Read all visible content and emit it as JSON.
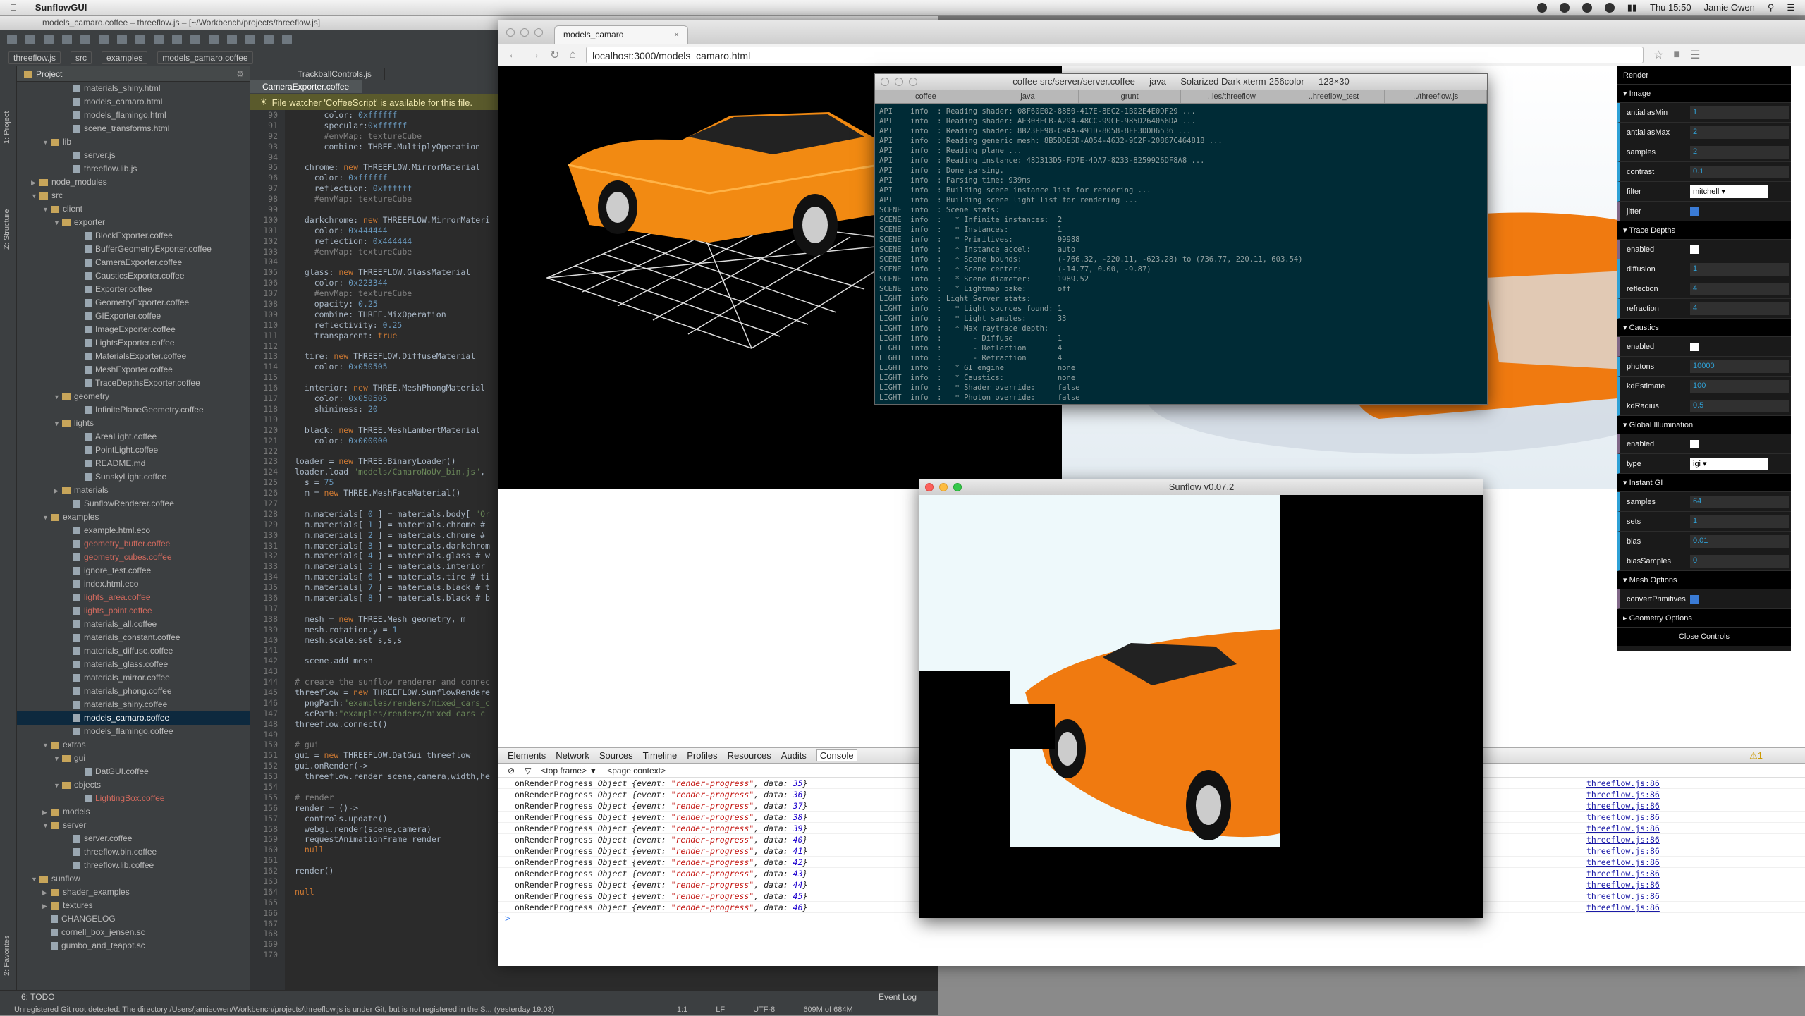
{
  "menubar": {
    "app": "SunflowGUI",
    "clock": "Thu 15:50",
    "user": "Jamie Owen"
  },
  "ide": {
    "title": "models_camaro.coffee – threeflow.js – [~/Workbench/projects/threeflow.js]",
    "crumbs": [
      "threeflow.js",
      "src",
      "examples",
      "models_camaro.coffee"
    ],
    "project_label": "Project",
    "side_labels": [
      "1: Project",
      "Z: Structure",
      "2: Favorites"
    ],
    "tree": [
      {
        "t": "materials_shiny.html",
        "d": 4,
        "k": "f"
      },
      {
        "t": "models_camaro.html",
        "d": 4,
        "k": "f"
      },
      {
        "t": "models_flamingo.html",
        "d": 4,
        "k": "f"
      },
      {
        "t": "scene_transforms.html",
        "d": 4,
        "k": "f"
      },
      {
        "t": "lib",
        "d": 2,
        "k": "o"
      },
      {
        "t": "server.js",
        "d": 4,
        "k": "f"
      },
      {
        "t": "threeflow.lib.js",
        "d": 4,
        "k": "f"
      },
      {
        "t": "node_modules",
        "d": 1,
        "k": "c"
      },
      {
        "t": "src",
        "d": 1,
        "k": "o"
      },
      {
        "t": "client",
        "d": 2,
        "k": "o"
      },
      {
        "t": "exporter",
        "d": 3,
        "k": "o"
      },
      {
        "t": "BlockExporter.coffee",
        "d": 5,
        "k": "f"
      },
      {
        "t": "BufferGeometryExporter.coffee",
        "d": 5,
        "k": "f"
      },
      {
        "t": "CameraExporter.coffee",
        "d": 5,
        "k": "f"
      },
      {
        "t": "CausticsExporter.coffee",
        "d": 5,
        "k": "f"
      },
      {
        "t": "Exporter.coffee",
        "d": 5,
        "k": "f"
      },
      {
        "t": "GeometryExporter.coffee",
        "d": 5,
        "k": "f"
      },
      {
        "t": "GIExporter.coffee",
        "d": 5,
        "k": "f"
      },
      {
        "t": "ImageExporter.coffee",
        "d": 5,
        "k": "f"
      },
      {
        "t": "LightsExporter.coffee",
        "d": 5,
        "k": "f"
      },
      {
        "t": "MaterialsExporter.coffee",
        "d": 5,
        "k": "f"
      },
      {
        "t": "MeshExporter.coffee",
        "d": 5,
        "k": "f"
      },
      {
        "t": "TraceDepthsExporter.coffee",
        "d": 5,
        "k": "f"
      },
      {
        "t": "geometry",
        "d": 3,
        "k": "o"
      },
      {
        "t": "InfinitePlaneGeometry.coffee",
        "d": 5,
        "k": "f"
      },
      {
        "t": "lights",
        "d": 3,
        "k": "o"
      },
      {
        "t": "AreaLight.coffee",
        "d": 5,
        "k": "f"
      },
      {
        "t": "PointLight.coffee",
        "d": 5,
        "k": "f"
      },
      {
        "t": "README.md",
        "d": 5,
        "k": "f"
      },
      {
        "t": "SunskyLight.coffee",
        "d": 5,
        "k": "f"
      },
      {
        "t": "materials",
        "d": 3,
        "k": "c"
      },
      {
        "t": "SunflowRenderer.coffee",
        "d": 4,
        "k": "f"
      },
      {
        "t": "examples",
        "d": 2,
        "k": "o"
      },
      {
        "t": "example.html.eco",
        "d": 4,
        "k": "f"
      },
      {
        "t": "geometry_buffer.coffee",
        "d": 4,
        "k": "f",
        "r": 1
      },
      {
        "t": "geometry_cubes.coffee",
        "d": 4,
        "k": "f",
        "r": 1
      },
      {
        "t": "ignore_test.coffee",
        "d": 4,
        "k": "f"
      },
      {
        "t": "index.html.eco",
        "d": 4,
        "k": "f"
      },
      {
        "t": "lights_area.coffee",
        "d": 4,
        "k": "f",
        "r": 1
      },
      {
        "t": "lights_point.coffee",
        "d": 4,
        "k": "f",
        "r": 1
      },
      {
        "t": "materials_all.coffee",
        "d": 4,
        "k": "f"
      },
      {
        "t": "materials_constant.coffee",
        "d": 4,
        "k": "f"
      },
      {
        "t": "materials_diffuse.coffee",
        "d": 4,
        "k": "f"
      },
      {
        "t": "materials_glass.coffee",
        "d": 4,
        "k": "f"
      },
      {
        "t": "materials_mirror.coffee",
        "d": 4,
        "k": "f"
      },
      {
        "t": "materials_phong.coffee",
        "d": 4,
        "k": "f"
      },
      {
        "t": "materials_shiny.coffee",
        "d": 4,
        "k": "f"
      },
      {
        "t": "models_camaro.coffee",
        "d": 4,
        "k": "f",
        "s": 1
      },
      {
        "t": "models_flamingo.coffee",
        "d": 4,
        "k": "f"
      },
      {
        "t": "extras",
        "d": 2,
        "k": "o"
      },
      {
        "t": "gui",
        "d": 3,
        "k": "o"
      },
      {
        "t": "DatGUI.coffee",
        "d": 5,
        "k": "f"
      },
      {
        "t": "objects",
        "d": 3,
        "k": "o"
      },
      {
        "t": "LightingBox.coffee",
        "d": 5,
        "k": "f",
        "r": 1
      },
      {
        "t": "models",
        "d": 2,
        "k": "c"
      },
      {
        "t": "server",
        "d": 2,
        "k": "o"
      },
      {
        "t": "server.coffee",
        "d": 4,
        "k": "f"
      },
      {
        "t": "threeflow.bin.coffee",
        "d": 4,
        "k": "f"
      },
      {
        "t": "threeflow.lib.coffee",
        "d": 4,
        "k": "f"
      },
      {
        "t": "sunflow",
        "d": 1,
        "k": "o"
      },
      {
        "t": "shader_examples",
        "d": 2,
        "k": "c"
      },
      {
        "t": "textures",
        "d": 2,
        "k": "c"
      },
      {
        "t": "CHANGELOG",
        "d": 2,
        "k": "f"
      },
      {
        "t": "cornell_box_jensen.sc",
        "d": 2,
        "k": "f"
      },
      {
        "t": "gumbo_and_teapot.sc",
        "d": 2,
        "k": "f"
      }
    ],
    "tabs": [
      "TrackballControls.js",
      "CameraExporter.coffee"
    ],
    "watcher": "File watcher 'CoffeeScript' is available for this file.",
    "first_line": 90,
    "code": [
      "      color: 0xffffff",
      "      specular:0xffffff",
      "      #envMap: textureCube",
      "      combine: THREE.MultiplyOperation",
      "",
      "  chrome: new THREEFLOW.MirrorMaterial",
      "    color: 0xffffff",
      "    reflection: 0xffffff",
      "    #envMap: textureCube",
      "",
      "  darkchrome: new THREEFLOW.MirrorMateri",
      "    color: 0x444444",
      "    reflection: 0x444444",
      "    #envMap: textureCube",
      "",
      "  glass: new THREEFLOW.GlassMaterial",
      "    color: 0x223344",
      "    #envMap: textureCube",
      "    opacity: 0.25",
      "    combine: THREE.MixOperation",
      "    reflectivity: 0.25",
      "    transparent: true",
      "",
      "  tire: new THREEFLOW.DiffuseMaterial",
      "    color: 0x050505",
      "",
      "  interior: new THREE.MeshPhongMaterial",
      "    color: 0x050505",
      "    shininess: 20",
      "",
      "  black: new THREE.MeshLambertMaterial",
      "    color: 0x000000",
      "",
      "loader = new THREE.BinaryLoader()",
      "loader.load \"models/CamaroNoUv_bin.js\",",
      "  s = 75",
      "  m = new THREE.MeshFaceMaterial()",
      "",
      "  m.materials[ 0 ] = materials.body[ \"Or",
      "  m.materials[ 1 ] = materials.chrome #",
      "  m.materials[ 2 ] = materials.chrome #",
      "  m.materials[ 3 ] = materials.darkchrom",
      "  m.materials[ 4 ] = materials.glass # w",
      "  m.materials[ 5 ] = materials.interior",
      "  m.materials[ 6 ] = materials.tire # ti",
      "  m.materials[ 7 ] = materials.black # t",
      "  m.materials[ 8 ] = materials.black # b",
      "",
      "  mesh = new THREE.Mesh geometry, m",
      "  mesh.rotation.y = 1",
      "  mesh.scale.set s,s,s",
      "",
      "  scene.add mesh",
      "",
      "# create the sunflow renderer and connec",
      "threeflow = new THREEFLOW.SunflowRendere",
      "  pngPath:\"examples/renders/mixed_cars_c",
      "  scPath:\"examples/renders/mixed_cars_c",
      "threeflow.connect()",
      "",
      "# gui",
      "gui = new THREEFLOW.DatGui threeflow",
      "gui.onRender(->",
      "  threeflow.render scene,camera,width,he",
      "",
      "# render",
      "render = ()->",
      "  controls.update()",
      "  webgl.render(scene,camera)",
      "  requestAnimationFrame render",
      "  null",
      "",
      "render()",
      "",
      "null",
      "",
      "",
      "",
      "",
      "",
      ""
    ],
    "bottom_tools": {
      "todo": "6: TODO",
      "event_log": "Event Log"
    },
    "status": {
      "message": "Unregistered Git root detected: The directory /Users/jamieowen/Workbench/projects/threeflow.js is under Git, but is not registered in the S... (yesterday 19:03)",
      "pos": "1:1",
      "lf": "LF",
      "enc": "UTF-8",
      "mem": "609M of 684M"
    }
  },
  "browser": {
    "tab": "models_camaro",
    "url": "localhost:3000/models_camaro.html",
    "devtools": {
      "tabs": [
        "Elements",
        "Network",
        "Sources",
        "Timeline",
        "Profiles",
        "Resources",
        "Audits",
        "Console"
      ],
      "active": "Console",
      "frame": "<top frame> ▼",
      "context": "<page context>",
      "warnings": "1",
      "log_prefix": "onRenderProgress",
      "log_obj": "Object {event: ",
      "log_event": "\"render-progress\"",
      "log_data": ", data: ",
      "log_source": "threeflow.js:86",
      "log_values": [
        35,
        36,
        37,
        38,
        39,
        40,
        41,
        42,
        43,
        44,
        45,
        46
      ],
      "prompt": ">"
    }
  },
  "terminal": {
    "title": "coffee src/server/server.coffee — java — Solarized Dark xterm-256color — 123×30",
    "tabs": [
      "coffee",
      "java",
      "grunt",
      "..les/threeflow",
      "..hreeflow_test",
      "../threeflow.js"
    ],
    "lines": [
      "API    info  : Reading shader: 08F60E02-8880-417E-8EC2-1B02E4E0DF29 ...",
      "API    info  : Reading shader: AE303FCB-A294-48CC-99CE-985D264056DA ...",
      "API    info  : Reading shader: 8B23FF98-C9AA-491D-8058-8FE3DDD6536 ...",
      "API    info  : Reading generic mesh: 8B5DDE5D-A054-4632-9C2F-20867C464818 ...",
      "API    info  : Reading plane ...",
      "API    info  : Reading instance: 48D313D5-FD7E-4DA7-8233-8259926DF8A8 ...",
      "API    info  : Done parsing.",
      "API    info  : Parsing time: 939ms",
      "API    info  : Building scene instance list for rendering ...",
      "API    info  : Building scene light list for rendering ...",
      "SCENE  info  : Scene stats:",
      "SCENE  info  :   * Infinite instances:  2",
      "SCENE  info  :   * Instances:           1",
      "SCENE  info  :   * Primitives:          99988",
      "SCENE  info  :   * Instance accel:      auto",
      "SCENE  info  :   * Scene bounds:        (-766.32, -220.11, -623.28) to (736.77, 220.11, 603.54)",
      "SCENE  info  :   * Scene center:        (-14.77, 0.00, -9.87)",
      "SCENE  info  :   * Scene diameter:      1989.52",
      "SCENE  info  :   * Lightmap bake:       off",
      "LIGHT  info  : Light Server stats:",
      "LIGHT  info  :   * Light sources found: 1",
      "LIGHT  info  :   * Light samples:       33",
      "LIGHT  info  :   * Max raytrace depth:",
      "LIGHT  info  :       - Diffuse          1",
      "LIGHT  info  :       - Reflection       4",
      "LIGHT  info  :       - Refraction       4",
      "LIGHT  info  :   * GI engine            none",
      "LIGHT  info  :   * Caustics:            none",
      "LIGHT  info  :   * Shader override:     false",
      "LIGHT  info  :   * Photon override:     false"
    ]
  },
  "sunflow": {
    "title": "Sunflow v0.07.2"
  },
  "render_panel": {
    "groups": [
      {
        "name": "Render",
        "top": true
      },
      {
        "name": "Image"
      },
      {
        "field": "antialiasMin",
        "value": "1"
      },
      {
        "field": "antialiasMax",
        "value": "2"
      },
      {
        "field": "samples",
        "value": "2"
      },
      {
        "field": "contrast",
        "value": "0.1"
      },
      {
        "field": "filter",
        "select": "mitchell"
      },
      {
        "field": "jitter",
        "check": true
      },
      {
        "name": "Trace Depths"
      },
      {
        "field": "enabled",
        "check": false
      },
      {
        "field": "diffusion",
        "value": "1"
      },
      {
        "field": "reflection",
        "value": "4"
      },
      {
        "field": "refraction",
        "value": "4"
      },
      {
        "name": "Caustics"
      },
      {
        "field": "enabled",
        "check": false
      },
      {
        "field": "photons",
        "value": "10000"
      },
      {
        "field": "kdEstimate",
        "value": "100"
      },
      {
        "field": "kdRadius",
        "value": "0.5"
      },
      {
        "name": "Global Illumination"
      },
      {
        "field": "enabled",
        "check": false
      },
      {
        "field": "type",
        "select": "igi"
      },
      {
        "name": "Instant GI"
      },
      {
        "field": "samples",
        "value": "64"
      },
      {
        "field": "sets",
        "value": "1"
      },
      {
        "field": "bias",
        "value": "0.01"
      },
      {
        "field": "biasSamples",
        "value": "0"
      },
      {
        "name": "Mesh Options"
      },
      {
        "field": "convertPrimitives",
        "check": true
      },
      {
        "name": "Geometry Options",
        "closed": true
      }
    ],
    "close": "Close Controls"
  },
  "colors": {
    "car_orange": "#f28a12",
    "solarized_bg": "#002b36",
    "dat_blue": "#2fa1d6"
  }
}
